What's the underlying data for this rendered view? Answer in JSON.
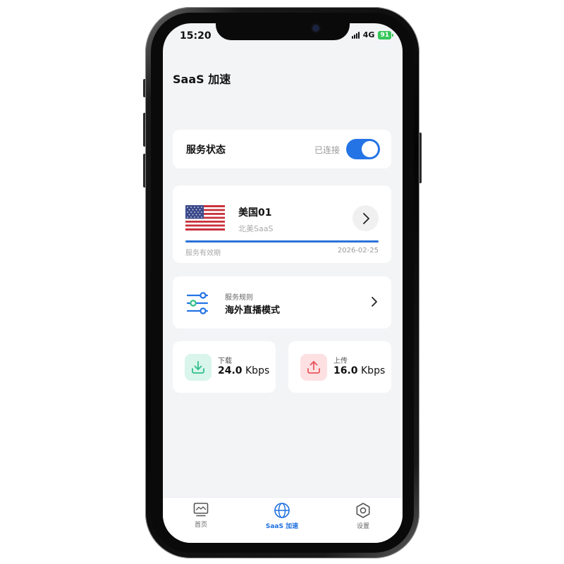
{
  "status_bar": {
    "time": "15:20",
    "network": "4G",
    "battery": "91"
  },
  "header": {
    "title": "SaaS 加速"
  },
  "service_status": {
    "label": "服务状态",
    "state": "已连接",
    "enabled": true
  },
  "server": {
    "name": "美国01",
    "subtitle": "北美SaaS",
    "expiry_label": "服务有效期",
    "expiry_date": "2026-02-25",
    "progress": 1.0
  },
  "rule": {
    "subtitle": "服务规则",
    "title": "海外直播模式"
  },
  "speed": {
    "download": {
      "label": "下载",
      "value": "24.0",
      "unit": "Kbps"
    },
    "upload": {
      "label": "上传",
      "value": "16.0",
      "unit": "Kbps"
    }
  },
  "tabs": [
    {
      "label": "首页",
      "icon": "monitor-icon",
      "active": false
    },
    {
      "label": "SaaS 加速",
      "icon": "globe-icon",
      "active": true
    },
    {
      "label": "设置",
      "icon": "gear-icon",
      "active": false
    }
  ],
  "colors": {
    "accent": "#2474e5",
    "download": "#2fbf8a",
    "upload": "#e9545e",
    "background": "#f3f4f6"
  }
}
